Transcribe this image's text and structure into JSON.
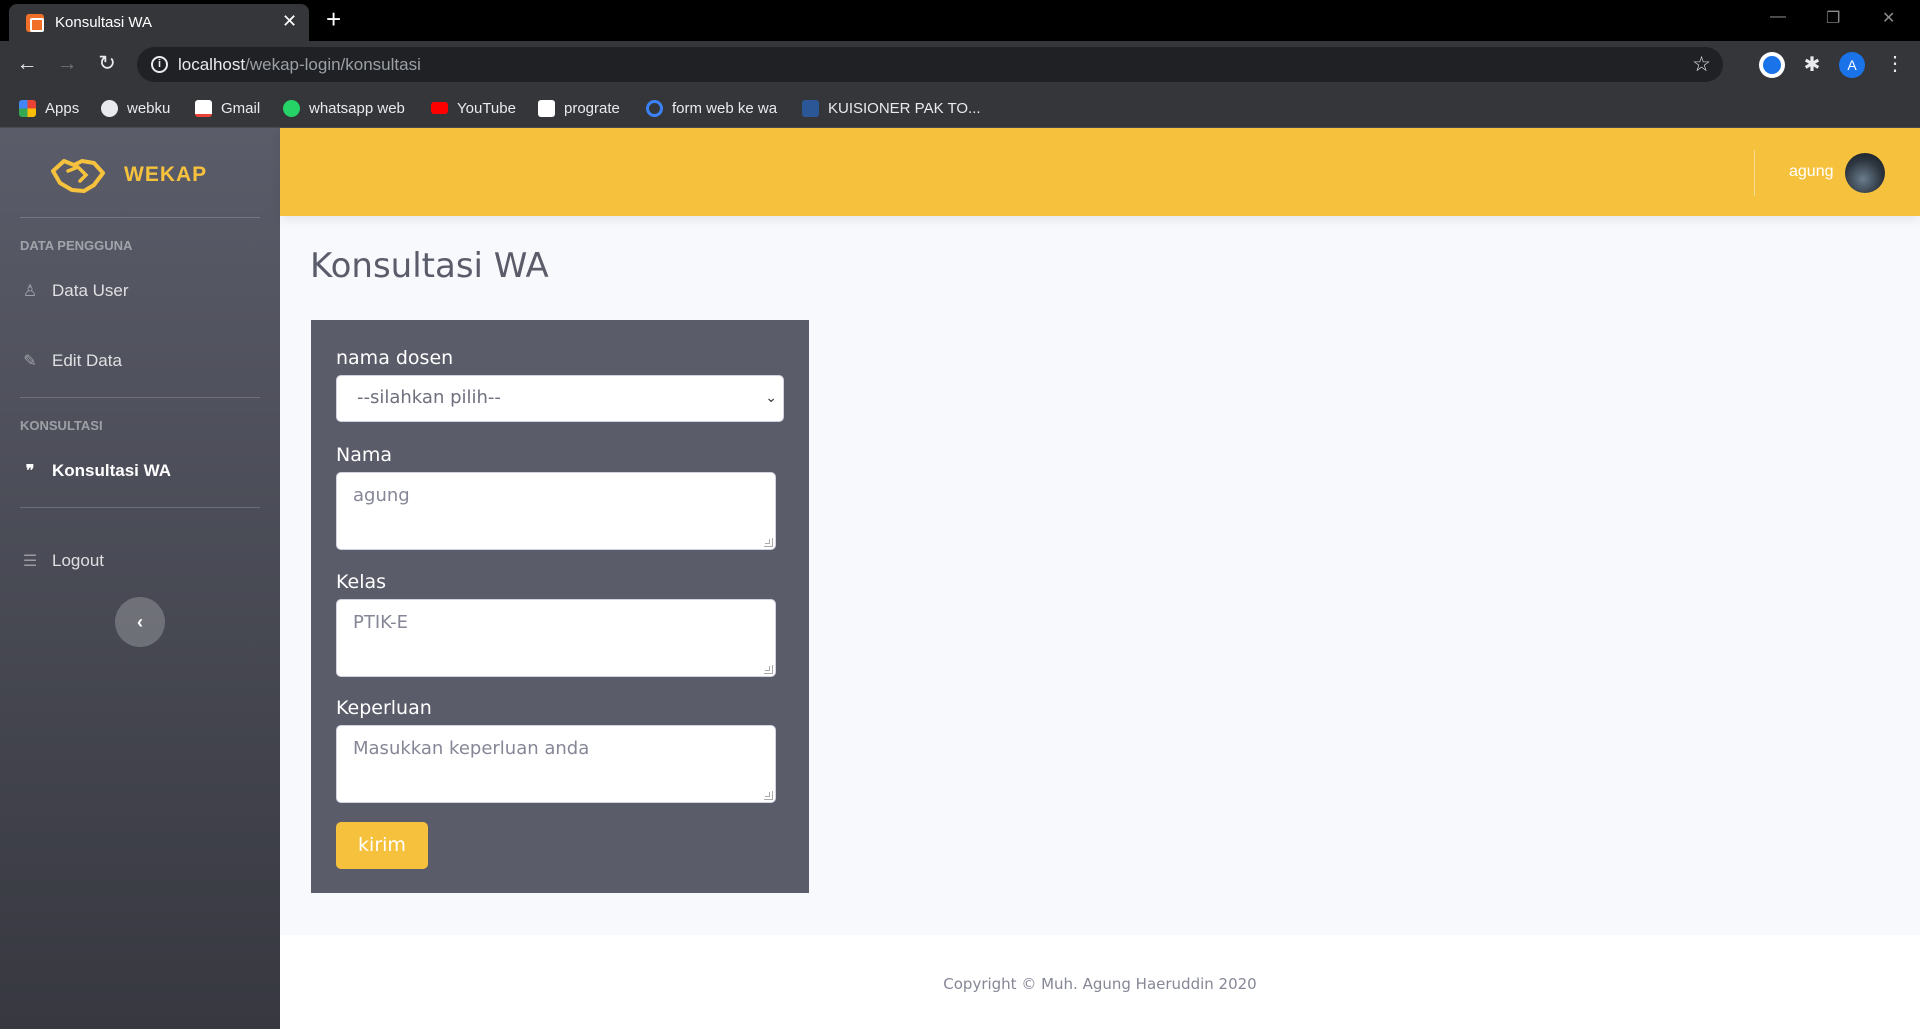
{
  "browser": {
    "tab_title": "Konsultasi WA",
    "tab_close": "✕",
    "new_tab": "+",
    "url_host": "localhost",
    "url_path": "/wekap-login/konsultasi",
    "profile_initial": "A",
    "bookmarks": [
      {
        "label": "Apps",
        "icon": "apps-grid-icon",
        "color": "#ea4335"
      },
      {
        "label": "webku",
        "icon": "globe-icon",
        "color": "#e8eaed"
      },
      {
        "label": "Gmail",
        "icon": "gmail-icon",
        "color": "#ea4335"
      },
      {
        "label": "whatsapp web",
        "icon": "whatsapp-icon",
        "color": "#25d366"
      },
      {
        "label": "YouTube",
        "icon": "youtube-icon",
        "color": "#ff0000"
      },
      {
        "label": "prograte",
        "icon": "prograte-icon",
        "color": "#ffffff"
      },
      {
        "label": "form web ke wa",
        "icon": "form-icon",
        "color": "#3b82f6"
      },
      {
        "label": "KUISIONER PAK TO...",
        "icon": "document-icon",
        "color": "#2b5797"
      }
    ]
  },
  "sidebar": {
    "brand": "WEKAP",
    "brand_color": "#f6c23e",
    "heading_users": "DATA PENGGUNA",
    "item_data_user": "Data User",
    "item_edit_data": "Edit Data",
    "heading_konsultasi": "KONSULTASI",
    "item_konsultasi_wa": "Konsultasi WA",
    "item_logout": "Logout",
    "toggle": "‹"
  },
  "topbar": {
    "user_name": "agung",
    "accent": "#f6c23e"
  },
  "main": {
    "page_title": "Konsultasi WA",
    "form": {
      "dosen_label": "nama dosen",
      "dosen_selected": "--silahkan pilih--",
      "nama_label": "Nama",
      "nama_value": "agung",
      "kelas_label": "Kelas",
      "kelas_value": "PTIK-E",
      "keperluan_label": "Keperluan",
      "keperluan_placeholder": "Masukkan keperluan anda",
      "submit_label": "kirim"
    }
  },
  "footer": {
    "copyright": "Copyright © Muh. Agung Haeruddin 2020"
  }
}
